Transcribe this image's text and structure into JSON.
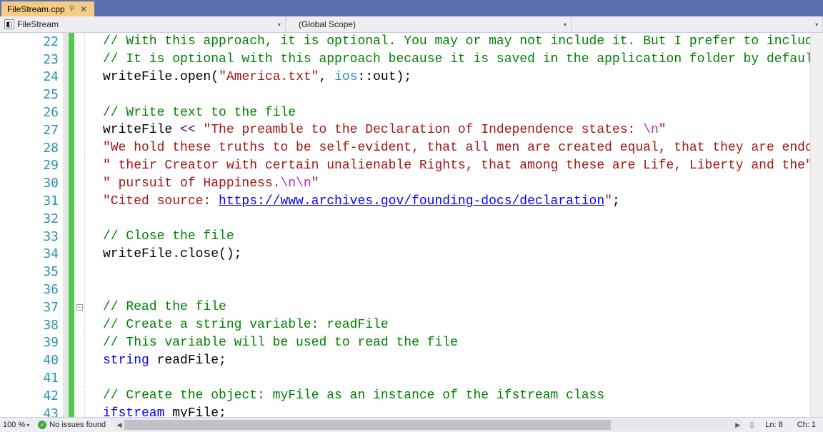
{
  "tab": {
    "label": "FileStream.cpp"
  },
  "nav": {
    "left_label": "FileStream",
    "scope_label": "(Global Scope)"
  },
  "status": {
    "zoom": "100 %",
    "issues": "No issues found",
    "line": "Ln: 8",
    "col": "Ch: 1"
  },
  "lines": [
    {
      "n": 22,
      "indent": 1,
      "tokens": [
        {
          "t": "cm",
          "v": "// With this approach, it is optional. You may or may not include it. But I prefer to include it"
        }
      ]
    },
    {
      "n": 23,
      "indent": 1,
      "tokens": [
        {
          "t": "cm",
          "v": "// It is optional with this approach because it is saved in the application folder by default"
        }
      ]
    },
    {
      "n": 24,
      "indent": 1,
      "tokens": [
        {
          "t": "ident",
          "v": "writeFile"
        },
        {
          "t": "ident",
          "v": "."
        },
        {
          "t": "ident",
          "v": "open"
        },
        {
          "t": "ident",
          "v": "("
        },
        {
          "t": "str",
          "v": "\"America.txt\""
        },
        {
          "t": "ident",
          "v": ", "
        },
        {
          "t": "ns",
          "v": "ios"
        },
        {
          "t": "ident",
          "v": "::"
        },
        {
          "t": "ident",
          "v": "out"
        },
        {
          "t": "ident",
          "v": ");"
        }
      ]
    },
    {
      "n": 25,
      "indent": 1,
      "tokens": []
    },
    {
      "n": 26,
      "indent": 1,
      "tokens": [
        {
          "t": "cm",
          "v": "// Write text to the file"
        }
      ]
    },
    {
      "n": 27,
      "indent": 1,
      "tokens": [
        {
          "t": "ident",
          "v": "writeFile "
        },
        {
          "t": "op",
          "v": "<<"
        },
        {
          "t": "ident",
          "v": " "
        },
        {
          "t": "str",
          "v": "\"The preamble to the Declaration of Independence states: "
        },
        {
          "t": "esc",
          "v": "\\n"
        },
        {
          "t": "str",
          "v": "\""
        }
      ]
    },
    {
      "n": 28,
      "indent": 2,
      "tokens": [
        {
          "t": "str",
          "v": "\"We hold these truths to be self-evident, that all men are created equal, that they are endowed by\""
        }
      ]
    },
    {
      "n": 29,
      "indent": 2,
      "tokens": [
        {
          "t": "str",
          "v": "\" their Creator with certain unalienable Rights, that among these are Life, Liberty and the\""
        }
      ]
    },
    {
      "n": 30,
      "indent": 2,
      "tokens": [
        {
          "t": "str",
          "v": "\" pursuit of Happiness."
        },
        {
          "t": "esc",
          "v": "\\n\\n"
        },
        {
          "t": "str",
          "v": "\""
        }
      ]
    },
    {
      "n": 31,
      "indent": 2,
      "tokens": [
        {
          "t": "str",
          "v": "\"Cited source: "
        },
        {
          "t": "url",
          "v": "https://www.archives.gov/founding-docs/declaration"
        },
        {
          "t": "str",
          "v": "\""
        },
        {
          "t": "ident",
          "v": ";"
        }
      ]
    },
    {
      "n": 32,
      "indent": 1,
      "tokens": []
    },
    {
      "n": 33,
      "indent": 1,
      "tokens": [
        {
          "t": "cm",
          "v": "// Close the file"
        }
      ]
    },
    {
      "n": 34,
      "indent": 1,
      "tokens": [
        {
          "t": "ident",
          "v": "writeFile"
        },
        {
          "t": "ident",
          "v": "."
        },
        {
          "t": "ident",
          "v": "close"
        },
        {
          "t": "ident",
          "v": "();"
        }
      ]
    },
    {
      "n": 35,
      "indent": 1,
      "tokens": []
    },
    {
      "n": 36,
      "indent": 1,
      "tokens": []
    },
    {
      "n": 37,
      "indent": 1,
      "fold": true,
      "tokens": [
        {
          "t": "cm",
          "v": "// Read the file"
        }
      ]
    },
    {
      "n": 38,
      "indent": 1,
      "tokens": [
        {
          "t": "cm",
          "v": "// Create a string variable: readFile"
        }
      ]
    },
    {
      "n": 39,
      "indent": 1,
      "tokens": [
        {
          "t": "cm",
          "v": "// This variable will be used to read the file"
        }
      ]
    },
    {
      "n": 40,
      "indent": 1,
      "tokens": [
        {
          "t": "kw",
          "v": "string"
        },
        {
          "t": "ident",
          "v": " readFile;"
        }
      ]
    },
    {
      "n": 41,
      "indent": 1,
      "tokens": []
    },
    {
      "n": 42,
      "indent": 1,
      "tokens": [
        {
          "t": "cm",
          "v": "// Create the object: myFile as an instance of the ifstream class"
        }
      ]
    },
    {
      "n": 43,
      "indent": 1,
      "tokens": [
        {
          "t": "kw",
          "v": "ifstream"
        },
        {
          "t": "ident",
          "v": " myFile;"
        }
      ]
    }
  ]
}
